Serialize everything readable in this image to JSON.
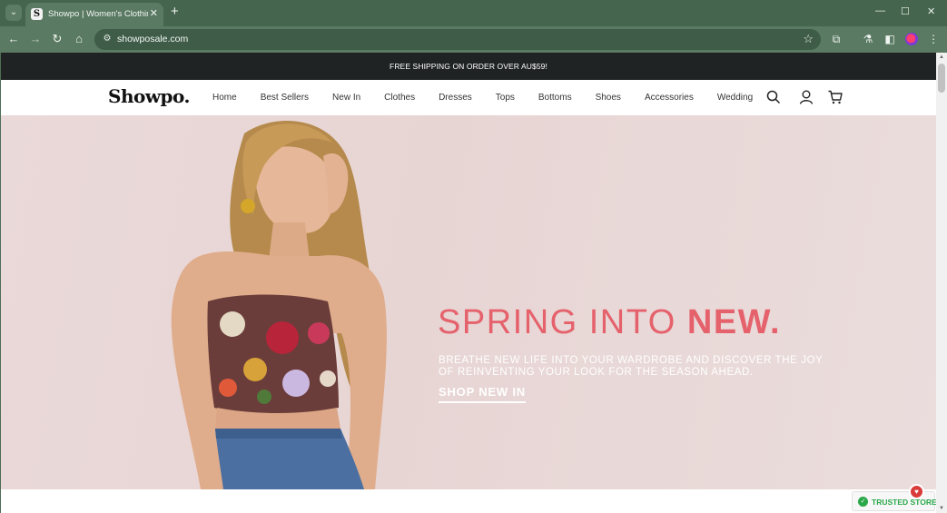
{
  "browser": {
    "tab": {
      "title": "Showpo | Women's Clothing | ",
      "favicon_letter": "S",
      "close_glyph": "✕"
    },
    "new_tab_glyph": "+",
    "tab_search_glyph": "⌄",
    "window_controls": {
      "minimize": "—",
      "maximize": "☐",
      "close": "✕"
    },
    "toolbar": {
      "back": "←",
      "forward": "→",
      "reload": "↻",
      "home": "⌂",
      "site_info": "⚙",
      "url": "showposale.com",
      "bookmark": "☆",
      "extensions": "⧉",
      "labs": "⚗",
      "sidebar": "◧",
      "menu": "⋮"
    }
  },
  "site": {
    "promo_bar": "FREE SHIPPING ON ORDER OVER AU$59!",
    "logo": "Showpo.",
    "nav": [
      "Home",
      "Best Sellers",
      "New In",
      "Clothes",
      "Dresses",
      "Tops",
      "Bottoms",
      "Shoes",
      "Accessories",
      "Wedding"
    ],
    "header_icons": [
      "search-icon",
      "account-icon",
      "cart-icon"
    ],
    "hero": {
      "headline_light": "SPRING INTO ",
      "headline_bold": "NEW.",
      "subheadline": "BREATHE NEW LIFE INTO YOUR WARDROBE AND DISCOVER THE JOY OF REINVENTING YOUR LOOK FOR THE SEASON AHEAD.",
      "cta": "SHOP NEW IN"
    },
    "trusted_badge": "TRUSTED STORE",
    "trusted_icon": "✓",
    "chat_icon": "♥"
  },
  "colors": {
    "browser_frame": "#46654f",
    "promo_bg": "#202324",
    "hero_bg": "#e9d8d7",
    "headline": "#e5626c",
    "trusted": "#2aa84a"
  }
}
